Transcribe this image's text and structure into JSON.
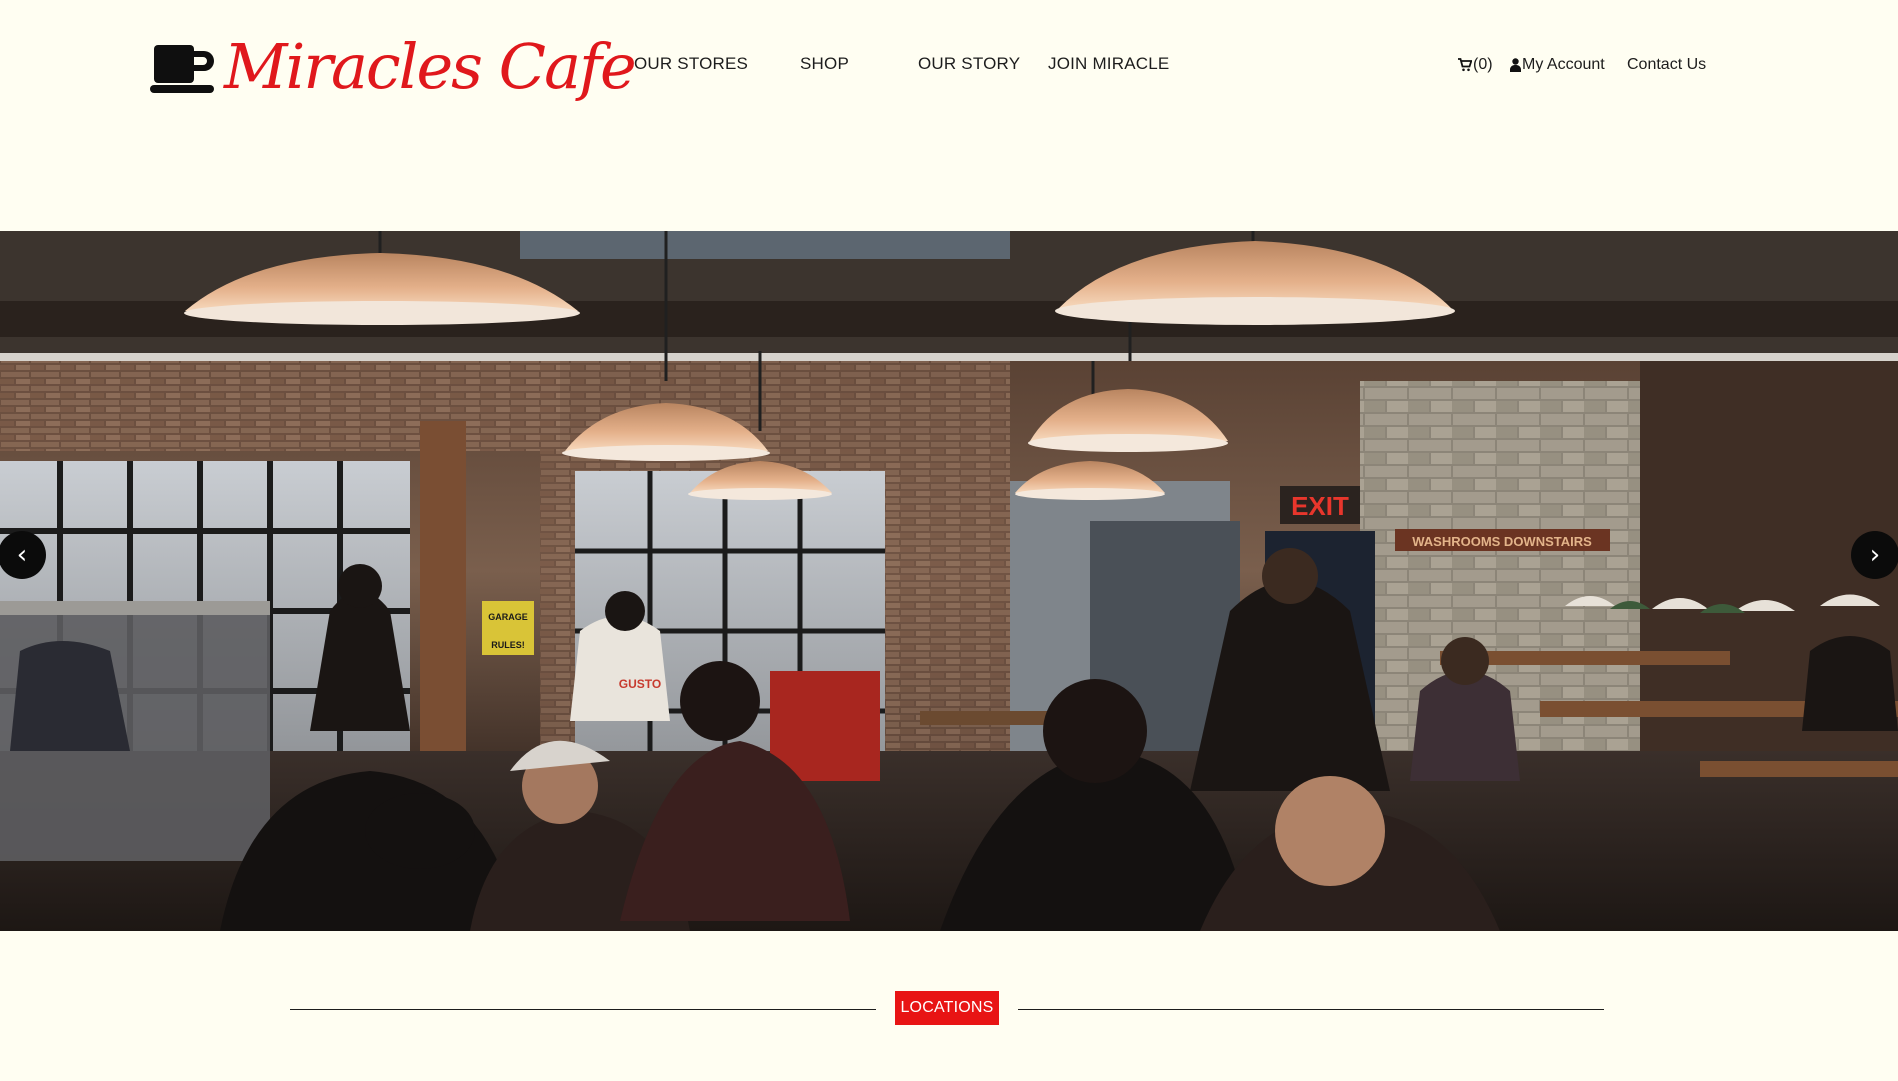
{
  "brand": {
    "name": "Miracles Cafe",
    "icon": "coffee-cup-icon",
    "color": "#e0181c"
  },
  "nav": {
    "items": [
      {
        "label": "OUR STORES"
      },
      {
        "label": "SHOP"
      },
      {
        "label": "OUR STORY"
      },
      {
        "label": "JOIN MIRACLE"
      }
    ]
  },
  "utility": {
    "cart": {
      "icon": "cart-icon",
      "count_label": "(0)"
    },
    "account": {
      "icon": "user-icon",
      "label": "My Account"
    },
    "contact": {
      "label": "Contact Us"
    }
  },
  "hero": {
    "prev_label": "‹",
    "next_label": "›",
    "sign_exit": "EXIT",
    "sign_washrooms": "WASHROOMS DOWNSTAIRS",
    "sign_gusto": "GUSTO",
    "sign_garage_1": "GARAGE",
    "sign_garage_2": "RULES!"
  },
  "sections": {
    "locations_label": "LOCATIONS"
  },
  "colors": {
    "background": "#fffef2",
    "accent": "#e81414",
    "text": "#1d1d1d"
  }
}
